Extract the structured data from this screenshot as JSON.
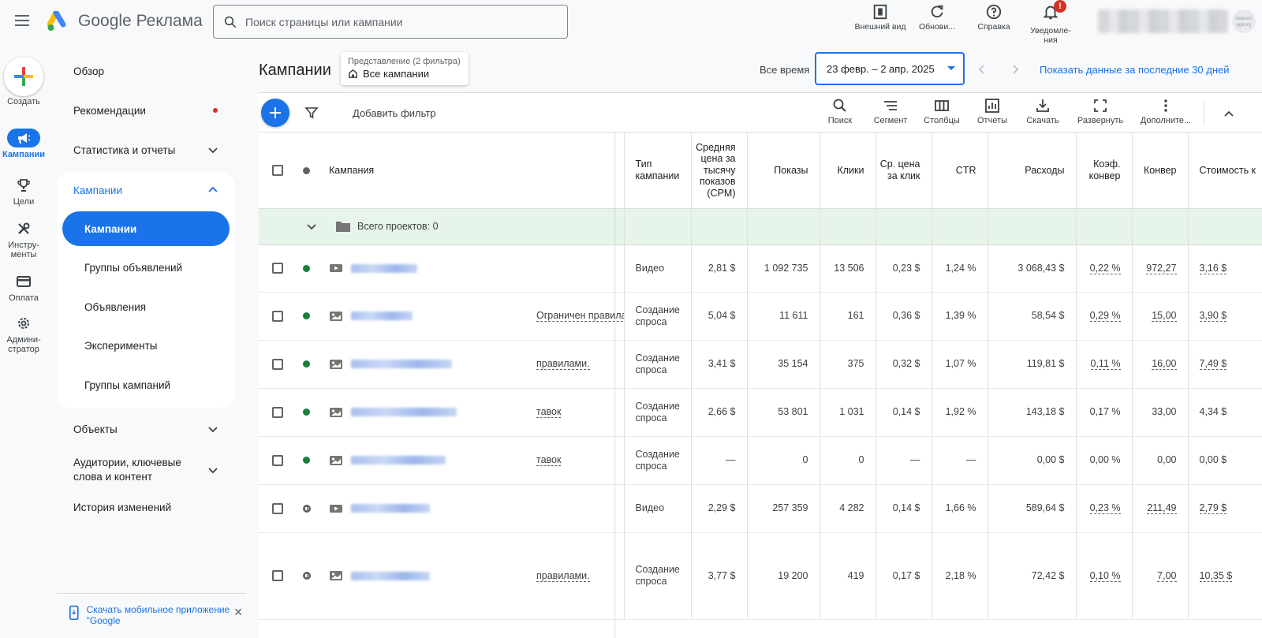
{
  "topbar": {
    "brand_google": "Google",
    "brand_product": "Реклама",
    "search_placeholder": "Поиск страницы или кампании",
    "actions": [
      {
        "label": "Внешний вид",
        "icon": "appearance-icon"
      },
      {
        "label": "Обнови...",
        "icon": "refresh-icon"
      },
      {
        "label": "Справка",
        "icon": "help-icon"
      },
      {
        "label": "Уведомле- ния",
        "icon": "bell-icon",
        "badge": "!"
      }
    ],
    "avatar_text": "kalanon agency"
  },
  "rail": {
    "create_label": "Создать",
    "items": [
      {
        "label": "Кампании",
        "icon": "megaphone-icon",
        "active": true
      },
      {
        "label": "Цели",
        "icon": "trophy-icon"
      },
      {
        "label": "Инстру- менты",
        "icon": "tools-icon"
      },
      {
        "label": "Оплата",
        "icon": "card-icon"
      },
      {
        "label": "Админи- стратор",
        "icon": "gear-icon"
      }
    ]
  },
  "sidenav": {
    "overview": "Обзор",
    "recommendations": "Рекомендации",
    "stats": "Статистика и отчеты",
    "campaigns_group": "Кампании",
    "sub_items": [
      "Кампании",
      "Группы объявлений",
      "Объявления",
      "Эксперименты",
      "Группы кампаний"
    ],
    "objects": "Объекты",
    "audiences": "Аудитории, ключевые слова и контент",
    "history": "История изменений",
    "app_banner": "Скачать мобильное приложение \"Google"
  },
  "header": {
    "title": "Кампании",
    "view_caption": "Представление (2 фильтра)",
    "view_value": "Все кампании",
    "all_time": "Все время",
    "date_range": "23 февр. – 2 апр. 2025",
    "last_30": "Показать данные за последние 30 дней"
  },
  "toolbar": {
    "add_filter": "Добавить фильтр",
    "tools": [
      {
        "label": "Поиск",
        "icon": "search-icon"
      },
      {
        "label": "Сегмент",
        "icon": "segment-icon"
      },
      {
        "label": "Столбцы",
        "icon": "columns-icon"
      },
      {
        "label": "Отчеты",
        "icon": "reports-icon"
      },
      {
        "label": "Скачать",
        "icon": "download-icon"
      },
      {
        "label": "Развернуть",
        "icon": "fullscreen-icon"
      },
      {
        "label": "Дополните...",
        "icon": "more-vert-icon"
      }
    ]
  },
  "table": {
    "headers": {
      "campaign": "Кампания",
      "type": "Тип кампании",
      "cpm": "Средняя цена за тысячу показов (CPM)",
      "impressions": "Показы",
      "clicks": "Клики",
      "cpc": "Ср. цена за клик",
      "ctr": "CTR",
      "cost": "Расходы",
      "conv_rate": "Коэф. конвер",
      "conversions": "Конвер",
      "cost_per_conv": "Стоимость к"
    },
    "total_label": "Всего проектов: 0",
    "rows": [
      {
        "status": "active",
        "channel": "video",
        "status_text": "",
        "type": "Видео",
        "cpm": "2,81 $",
        "impressions": "1 092 735",
        "clicks": "13 506",
        "cpc": "0,23 $",
        "ctr": "1,24 %",
        "cost": "3 068,43 $",
        "conv_rate": "0,22 %",
        "conversions": "972,27",
        "cost_per_conv": "3,16 $"
      },
      {
        "status": "active",
        "channel": "display",
        "status_text": "Ограничен правилами",
        "type": "Создание спроса",
        "cpm": "5,04 $",
        "impressions": "11 611",
        "clicks": "161",
        "cpc": "0,36 $",
        "ctr": "1,39 %",
        "cost": "58,54 $",
        "conv_rate": "0,29 %",
        "conversions": "15,00",
        "cost_per_conv": "3,90 $"
      },
      {
        "status": "active",
        "channel": "display",
        "status_text": "правилами.",
        "type": "Создание спроса",
        "cpm": "3,41 $",
        "impressions": "35 154",
        "clicks": "375",
        "cpc": "0,32 $",
        "ctr": "1,07 %",
        "cost": "119,81 $",
        "conv_rate": "0,11 %",
        "conversions": "16,00",
        "cost_per_conv": "7,49 $"
      },
      {
        "status": "active",
        "channel": "display",
        "status_text": "тавок",
        "type": "Создание спроса",
        "cpm": "2,66 $",
        "impressions": "53 801",
        "clicks": "1 031",
        "cpc": "0,14 $",
        "ctr": "1,92 %",
        "cost": "143,18 $",
        "conv_rate": "0,17 %",
        "conversions": "33,00",
        "cost_per_conv": "4,34 $"
      },
      {
        "status": "active",
        "channel": "display",
        "status_text": "тавок",
        "type": "Создание спроса",
        "cpm": "—",
        "impressions": "0",
        "clicks": "0",
        "cpc": "—",
        "ctr": "—",
        "cost": "0,00 $",
        "conv_rate": "0,00 %",
        "conversions": "0,00",
        "cost_per_conv": "0,00 $"
      },
      {
        "status": "paused",
        "channel": "video",
        "status_text": "",
        "type": "Видео",
        "cpm": "2,29 $",
        "impressions": "257 359",
        "clicks": "4 282",
        "cpc": "0,14 $",
        "ctr": "1,66 %",
        "cost": "589,64 $",
        "conv_rate": "0,23 %",
        "conversions": "211,49",
        "cost_per_conv": "2,79 $"
      },
      {
        "status": "paused",
        "channel": "display",
        "status_text": "правилами.",
        "type": "Создание спроса",
        "cpm": "3,77 $",
        "impressions": "19 200",
        "clicks": "419",
        "cpc": "0,17 $",
        "ctr": "2,18 %",
        "cost": "72,42 $",
        "conv_rate": "0,10 %",
        "conversions": "7,00",
        "cost_per_conv": "10,35 $"
      }
    ]
  },
  "colors": {
    "accent": "#1a73e8",
    "active_status": "#188038",
    "total_row": "#e6f4ea",
    "badge": "#d93025"
  }
}
